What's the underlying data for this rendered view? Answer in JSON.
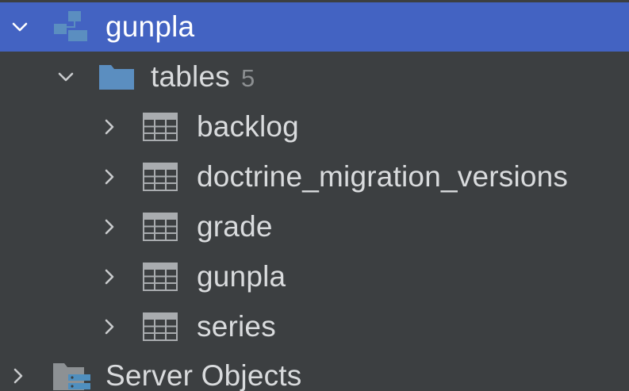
{
  "tree": {
    "schema": {
      "label": "gunpla"
    },
    "tables_folder": {
      "label": "tables",
      "count": "5"
    },
    "tables": [
      {
        "label": "backlog"
      },
      {
        "label": "doctrine_migration_versions"
      },
      {
        "label": "grade"
      },
      {
        "label": "gunpla"
      },
      {
        "label": "series"
      }
    ],
    "server_objects": {
      "label": "Server Objects"
    }
  },
  "colors": {
    "background": "#3c3f41",
    "selection": "#4363c2",
    "text": "#d9dbdd",
    "muted": "#8c8f91",
    "folder": "#5b8ec0",
    "table_icon": "#a9acaf"
  },
  "icons": {
    "expanded": "chevron-down-icon",
    "collapsed": "chevron-right-icon",
    "schema": "schema-icon",
    "folder": "folder-icon",
    "table": "table-icon",
    "server_objects": "server-objects-icon"
  }
}
